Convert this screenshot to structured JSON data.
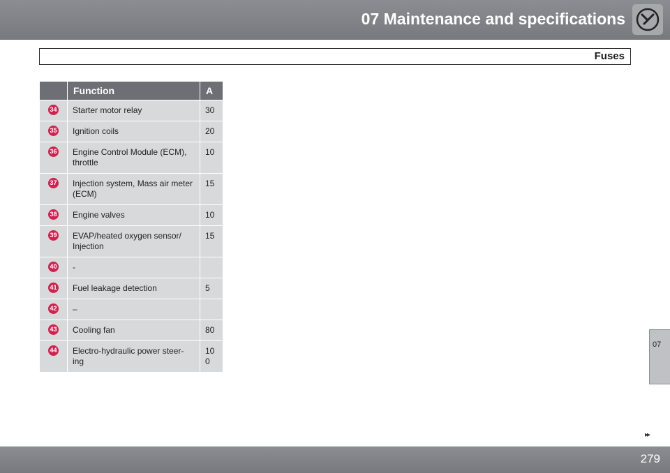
{
  "header": {
    "title": "07 Maintenance and specifications",
    "icon": "wrench-icon"
  },
  "section": {
    "title": "Fuses"
  },
  "table": {
    "headers": [
      "",
      "Function",
      "A"
    ],
    "rows": [
      {
        "num": "34",
        "function": "Starter motor relay",
        "amps": "30"
      },
      {
        "num": "35",
        "function": "Ignition coils",
        "amps": "20"
      },
      {
        "num": "36",
        "function": "Engine Control Module (ECM), throttle",
        "amps": "10"
      },
      {
        "num": "37",
        "function": "Injection system, Mass air meter (ECM)",
        "amps": "15"
      },
      {
        "num": "38",
        "function": "Engine valves",
        "amps": "10"
      },
      {
        "num": "39",
        "function": "EVAP/heated oxygen sensor/ Injection",
        "amps": "15"
      },
      {
        "num": "40",
        "function": "-",
        "amps": ""
      },
      {
        "num": "41",
        "function": "Fuel leakage detection",
        "amps": "5"
      },
      {
        "num": "42",
        "function": "–",
        "amps": ""
      },
      {
        "num": "43",
        "function": "Cooling fan",
        "amps": "80"
      },
      {
        "num": "44",
        "function": "Electro-hydraulic power steer-ing",
        "amps": "100"
      }
    ]
  },
  "chapter_tab": {
    "label": "07"
  },
  "footer": {
    "next_page": "▸▸",
    "page_number": "279"
  },
  "colors": {
    "bar": "#7c7f84",
    "fuse_badge": "#d3204f",
    "cell": "#d8d9db"
  }
}
